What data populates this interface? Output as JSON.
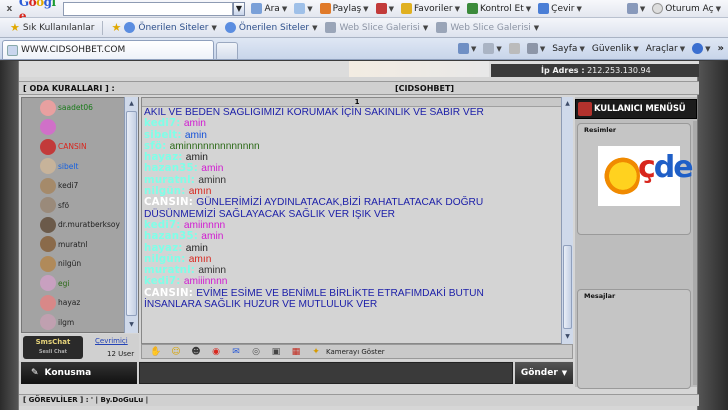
{
  "browser": {
    "google_label": "Google",
    "toolbar": {
      "ara": "Ara",
      "paylas": "Paylaş",
      "favoriler": "Favoriler",
      "kontrol_et": "Kontrol Et",
      "cevir": "Çevir",
      "oturum_ac": "Oturum Aç"
    },
    "favorites_bar": {
      "sik_kullanilanlar": "Sık Kullanılanlar",
      "links": [
        "Önerilen Siteler",
        "Önerilen Siteler",
        "Web Slice Galerisi",
        "Web Slice Galerisi"
      ]
    },
    "tab_title": "WWW.CIDSOHBET.COM",
    "command_bar": {
      "sayfa": "Sayfa",
      "guvenlik": "Güvenlik",
      "araclar": "Araçlar"
    }
  },
  "page": {
    "ip_label": "İp Adres :",
    "ip_value": "212.253.130.94",
    "oda_kurallari": "[ ODA KURALLARI ] :",
    "room_name": "[CIDSOHBET]",
    "users": [
      {
        "name": "saadet06",
        "color": "#1a7a1a"
      },
      {
        "name": "",
        "color": "#d41ad4"
      },
      {
        "name": "CANSIN",
        "color": "#d8261d"
      },
      {
        "name": "sibelt",
        "color": "#1660e0"
      },
      {
        "name": "kedi7",
        "color": "#222222"
      },
      {
        "name": "sfö",
        "color": "#222222"
      },
      {
        "name": "dr.muratberksoy",
        "color": "#222222"
      },
      {
        "name": "muratnl",
        "color": "#222222"
      },
      {
        "name": "nilgün",
        "color": "#222222"
      },
      {
        "name": "egi",
        "color": "#2c6a18"
      },
      {
        "name": "hayaz",
        "color": "#222222"
      },
      {
        "name": "ilgm",
        "color": "#222222"
      }
    ],
    "online_label": "Çevrimiçi",
    "user_count": "12 User",
    "small_logo_text": "SmsChat",
    "small_logo_sub": "Sesli Chat",
    "chat_page_number": "1",
    "messages": [
      {
        "nick": "",
        "text": "AKIL VE BEDEN SAGLIGIMIZI KORUMAK İÇİN SAKINLIK VE SABIR VER",
        "color": "#1b1ea8"
      },
      {
        "nick": "kedi7:",
        "text": "amin",
        "color": "#d11ad1"
      },
      {
        "nick": "sibelt:",
        "text": "amin",
        "color": "#1450d8"
      },
      {
        "nick": "sfö:",
        "text": "aminnnnnnnnnnnnn",
        "color": "#2c6a18"
      },
      {
        "nick": "hayaz:",
        "text": "amin",
        "color": "#222222"
      },
      {
        "nick": "hazan35:",
        "text": "amin",
        "color": "#d11ad1"
      },
      {
        "nick": "muratnl:",
        "text": "aminn",
        "color": "#333333"
      },
      {
        "nick": "nilgün:",
        "text": "amın",
        "color": "#d8261d"
      },
      {
        "nick": "CANSIN:",
        "text": "GÜNLERİMİZİ AYDINLATACAK,BİZİ RAHATLATACAK DOĞRU",
        "color": "#1b1ea8"
      },
      {
        "nick": "",
        "text": "DÜSÜNMEMİZİ SAĞLAYACAK SAĞLIK VER IŞIK VER",
        "color": "#1b1ea8"
      },
      {
        "nick": "kedi7:",
        "text": "amiinnnn",
        "color": "#d11ad1"
      },
      {
        "nick": "hazan35:",
        "text": "amin",
        "color": "#d11ad1"
      },
      {
        "nick": "hayaz:",
        "text": "amin",
        "color": "#222222"
      },
      {
        "nick": "nilgün:",
        "text": "amın",
        "color": "#d8261d"
      },
      {
        "nick": "muratnl:",
        "text": "aminn",
        "color": "#333333"
      },
      {
        "nick": "kedi7:",
        "text": "amiiinnnn",
        "color": "#d11ad1"
      },
      {
        "nick": "CANSIN:",
        "text": "EVİME ESİME VE BENİMLE BİRLİKTE ETRAFIMDAKİ BUTUN",
        "color": "#1b1ea8"
      },
      {
        "nick": "",
        "text": "İNSANLARA SAĞLIK HUZUR VE MUTLULUK VER",
        "color": "#1b1ea8"
      }
    ],
    "kamera_label": "Kamerayı Göster",
    "konusma_label": "Konusma",
    "gonder_label": "Gönder",
    "gorevliler": "[ GÖREVLİLER ] : ' | By.DoGuLu |",
    "right_panel": {
      "title": "KULLANICI MENÜSÜ",
      "resimler": "Resimler",
      "mesajlar": "Mesajlar",
      "logo_text_red": "ç",
      "logo_text_blue": "d",
      "logo_text_blue2": "e"
    }
  }
}
